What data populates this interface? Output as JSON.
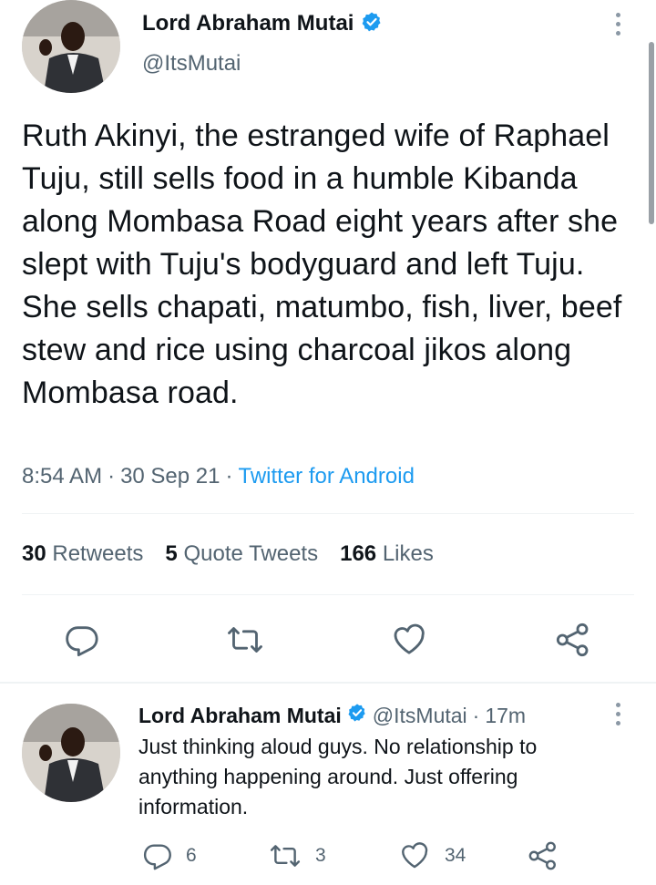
{
  "main_tweet": {
    "author_name": "Lord Abraham Mutai",
    "handle": "@ItsMutai",
    "text": "Ruth Akinyi, the estranged wife of Raphael Tuju, still sells food in a humble Kibanda along Mombasa Road eight years after she slept with Tuju's bodyguard and left Tuju. She sells chapati, matumbo, fish, liver, beef stew and rice using charcoal jikos along Mombasa road.",
    "time": "8:54 AM",
    "date": "30 Sep 21",
    "separator": "·",
    "source": "Twitter for Android",
    "retweets_count": "30",
    "retweets_label": "Retweets",
    "quote_count": "5",
    "quote_label": "Quote Tweets",
    "likes_count": "166",
    "likes_label": "Likes"
  },
  "reply": {
    "author_name": "Lord Abraham Mutai",
    "handle": "@ItsMutai",
    "separator": "·",
    "age": "17m",
    "text": "Just thinking aloud guys. No relationship to anything happening around. Just offering information.",
    "reply_count": "6",
    "retweet_count": "3",
    "like_count": "34"
  },
  "colors": {
    "accent": "#1d9bf0",
    "text": "#0f1419",
    "secondary": "#536471"
  },
  "icons": [
    "verified-badge-icon",
    "more-icon",
    "reply-icon",
    "retweet-icon",
    "like-icon",
    "share-icon"
  ]
}
